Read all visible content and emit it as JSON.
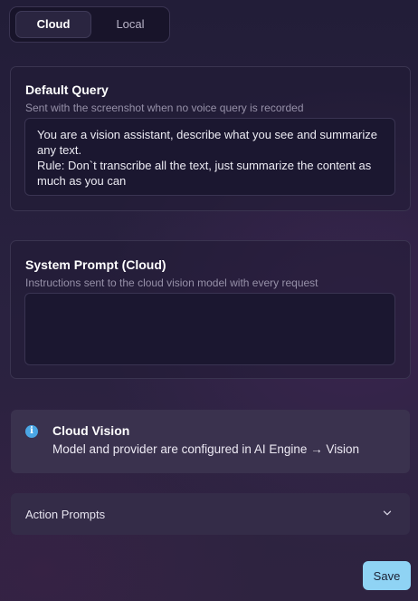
{
  "tabs": {
    "cloud_label": "Cloud",
    "local_label": "Local",
    "active": "Cloud"
  },
  "default_query": {
    "title": "Default Query",
    "subtitle": "Sent with the screenshot when no voice query is recorded",
    "value": "You are a vision assistant, describe what you see and summarize any text.\nRule: Don`t transcribe all the text, just summarize the content as much as you can"
  },
  "system_prompt": {
    "title": "System Prompt (Cloud)",
    "subtitle": "Instructions sent to the cloud vision model with every request",
    "value": ""
  },
  "info": {
    "icon": "info-icon",
    "icon_glyph": "i",
    "title": "Cloud Vision",
    "body": "Model and provider are configured in AI Engine → Vision"
  },
  "action_prompts": {
    "label": "Action Prompts",
    "icon": "chevron-down-icon",
    "expanded": false
  },
  "save_label": "Save",
  "colors": {
    "accent": "#8fd3f4",
    "info_icon": "#4aa6e4"
  }
}
